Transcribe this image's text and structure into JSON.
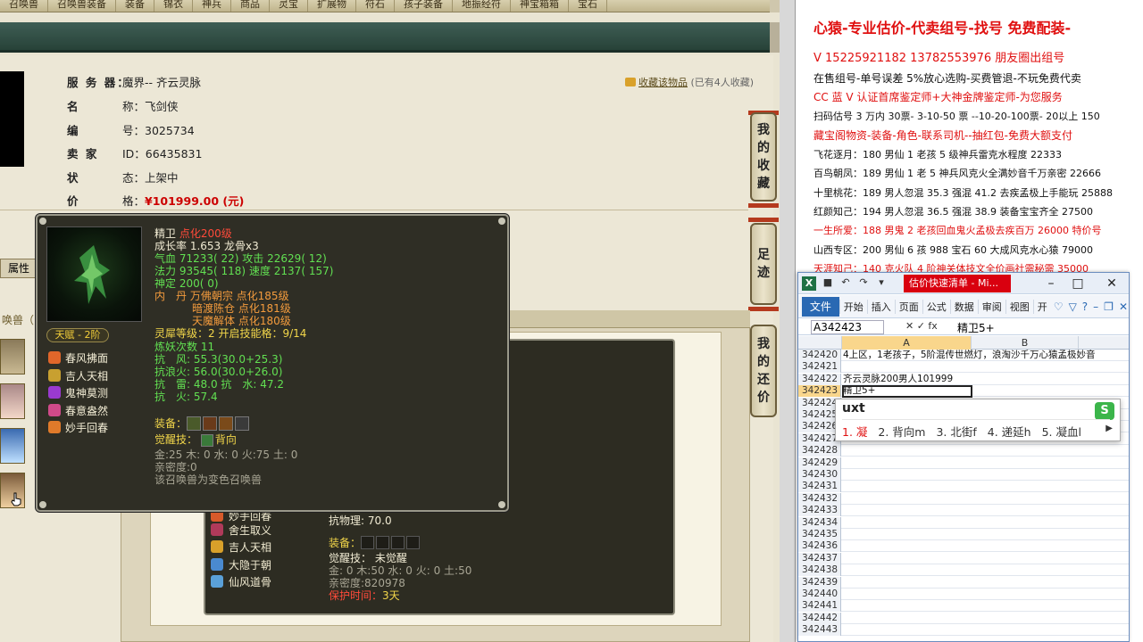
{
  "topnav": [
    "召唤兽",
    "召唤兽装备",
    "装备",
    "锦衣",
    "神兵",
    "商品",
    "灵宝",
    "扩展物",
    "符石",
    "孩子装备",
    "地振经符",
    "神宝箱箱",
    "宝石"
  ],
  "listing": {
    "rows": [
      {
        "label": "服 务 器：",
        "value": "魔界-- 齐云灵脉"
      },
      {
        "label": "名",
        "value": "称：飞剑侠"
      },
      {
        "label": "编",
        "value": "号：3025734"
      },
      {
        "label": "卖 家",
        "value": "ID：66435831"
      },
      {
        "label": "状",
        "value": "态：上架中"
      },
      {
        "label": "价",
        "value": "格："
      }
    ],
    "price": "¥101999.00 (元)",
    "fav_link": "收藏该物品",
    "fav_count": "(已有4人收藏)"
  },
  "side_buttons": [
    {
      "name": "my-favorites",
      "chars": [
        "我",
        "的",
        "收",
        "藏"
      ]
    },
    {
      "name": "footprint",
      "chars": [
        "足",
        "迹"
      ]
    },
    {
      "name": "my-bargain",
      "chars": [
        "我",
        "的",
        "还",
        "价"
      ]
    }
  ],
  "tabs": {
    "attr": "属性"
  },
  "summon_header": "唤兽（",
  "tooltip": {
    "name": "精卫",
    "level": "点化200级",
    "growth": "成长率 1.653 龙骨x3",
    "hp_label": "气血",
    "hp": "71233( 22)",
    "atk_label": "攻击",
    "atk": "22629( 12)",
    "mp_label": "法力",
    "mp": "93545( 118)",
    "spd_label": "速度",
    "spd": "2137( 157)",
    "shen": "神定 200( 0)",
    "neidan_label": "内　丹",
    "neidan": [
      "万佛朝宗 点化185级",
      "暗渡陈仓 点化181级",
      "天魔解体 点化180级"
    ],
    "lingxi": "灵犀等级：2 开启技能格：9/14",
    "lianyao": "炼妖次数 11",
    "resist": [
      "抗　风: 55.3(30.0+25.3)",
      "抗浪火: 56.0(30.0+26.0)",
      "抗　雷: 48.0 抗　水: 47.2",
      "抗　火: 57.4"
    ],
    "equip_label": "装备：",
    "awaken_label": "觉醒技：",
    "awaken": "背向",
    "elements": "金:25 木: 0 水: 0 火:75 土: 0",
    "intimacy": "亲密度:0",
    "note": "该召唤兽为变色召唤兽",
    "talent": "天赋 - 2阶",
    "skills": [
      "春风拂面",
      "吉人天相",
      "鬼神莫测",
      "春意盎然",
      "妙手回春"
    ]
  },
  "back_panel": {
    "skills": [
      "妙手回春",
      "舍生取义",
      "吉人天相",
      "大隐于朝",
      "仙风道骨"
    ],
    "resist": "抗物理: 70.0",
    "equip_label": "装备：",
    "awaken": "觉醒技： 未觉醒",
    "elements": "金: 0 木:50 水: 0 火: 0 土:50",
    "intimacy": "亲密度:820978",
    "protect_label": "保护时间：",
    "protect": "3天"
  },
  "ads": {
    "headline": "心猿-专业估价-代卖组号-找号 免费配装-",
    "line1": "V 15225921182  13782553976 朋友圈出组号",
    "line2": "在售组号-单号误差 5%放心选购-买费管退-不玩免费代卖",
    "line3": "CC 蓝 V 认证首席鉴定师+大神金牌鉴定师-为您服务",
    "line4": "扫码估号 3 万内 30票- 3-10-50 票  --10-20-100票- 20以上 150",
    "line5": "藏宝阁物资-装备-角色-联系司机--抽红包-免费大额支付",
    "list": [
      {
        "text": "飞花逐月：180 男仙 1 老孩 5 级神兵雷克水程度 22333",
        "red": false
      },
      {
        "text": "百鸟朝凤：189 男仙 1 老 5 神兵风克火全满妙音千万亲密 22666",
        "red": false
      },
      {
        "text": "十里桃花：189 男人忽混 35.3 强混 41.2 去疾孟极上手能玩 25888",
        "red": false
      },
      {
        "text": "红颜知己：194 男人忽混 36.5 强混 38.9 装备宝宝齐全 27500",
        "red": false
      },
      {
        "text": "一生所爱：188 男鬼 2 老孩回血鬼火孟极去疾百万 26000 特价号",
        "red": true
      },
      {
        "text": "山西专区：200 男仙 6 孩 988 宝石 60 大成风克水心猿 79000",
        "red": false
      },
      {
        "text": "天涯知己：140 克火队 4 阶神关体技文全价画社需秘需 35000",
        "red": true
      }
    ]
  },
  "excel": {
    "title": "估价快速清单 - Mi...",
    "ribbon": [
      "文件",
      "开始",
      "插入",
      "页面",
      "公式",
      "数据",
      "审阅",
      "视图",
      "开"
    ],
    "namebox": "A342423",
    "formula": "精卫5+",
    "col_a": "A",
    "col_b": "B",
    "rows": [
      {
        "n": "342420",
        "v": "4上区，1老孩子，5阶混传世燃灯，浪淘沙千万心猿孟极妙音"
      },
      {
        "n": "342421",
        "v": ""
      },
      {
        "n": "342422",
        "v": "齐云灵脉200男人101999"
      },
      {
        "n": "342423",
        "v": "精卫5+"
      },
      {
        "n": "342424",
        "v": ""
      },
      {
        "n": "342425",
        "v": ""
      },
      {
        "n": "342426",
        "v": ""
      },
      {
        "n": "342427",
        "v": ""
      },
      {
        "n": "342428",
        "v": ""
      },
      {
        "n": "342429",
        "v": ""
      },
      {
        "n": "342430",
        "v": ""
      },
      {
        "n": "342431",
        "v": ""
      },
      {
        "n": "342432",
        "v": ""
      },
      {
        "n": "342433",
        "v": ""
      },
      {
        "n": "342434",
        "v": ""
      },
      {
        "n": "342435",
        "v": ""
      },
      {
        "n": "342436",
        "v": ""
      },
      {
        "n": "342437",
        "v": ""
      },
      {
        "n": "342438",
        "v": ""
      },
      {
        "n": "342439",
        "v": ""
      },
      {
        "n": "342440",
        "v": ""
      },
      {
        "n": "342441",
        "v": ""
      },
      {
        "n": "342442",
        "v": ""
      },
      {
        "n": "342443",
        "v": ""
      }
    ]
  },
  "ime": {
    "composition": "uxt",
    "candidates": [
      "1. 凝",
      "2. 背向m",
      "3. 北街f",
      "4. 递延h",
      "5. 凝血l"
    ]
  }
}
